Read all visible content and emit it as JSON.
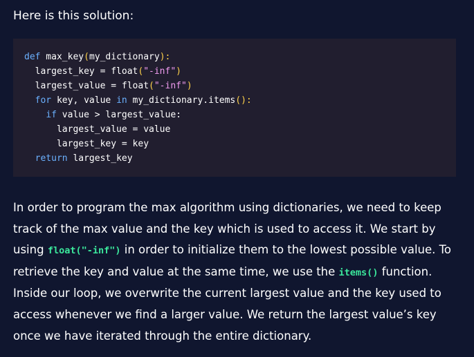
{
  "intro": "Here is this solution:",
  "code": {
    "l1": {
      "kw": "def",
      "fn": " max_key",
      "p1": "(",
      "arg": "my_dictionary",
      "p2": "):"
    },
    "l2": {
      "a": "largest_key = float",
      "p1": "(",
      "s": "\"-inf\"",
      "p2": ")"
    },
    "l3": {
      "a": "largest_value = float",
      "p1": "(",
      "s": "\"-inf\"",
      "p2": ")"
    },
    "l4": {
      "kw1": "for",
      "a": " key, value ",
      "kw2": "in",
      "b": " my_dictionary.items",
      "p": "():"
    },
    "l5": {
      "kw": "if",
      "a": " value > largest_value:"
    },
    "l6": "largest_value = value",
    "l7": "largest_key = key",
    "l8": {
      "kw": "return",
      "a": " largest_key"
    }
  },
  "prose": {
    "t1": "In order to program the max algorithm using dictionaries, we need to keep track of the max value and the key which is used to access it. We start by using ",
    "c1": "float(\"-inf\")",
    "t2": " in order to initialize them to the lowest possible value. To retrieve the key and value at the same time, we use the ",
    "c2": "items()",
    "t3": " function. Inside our loop, we overwrite the current largest value and the key used to access whenever we find a larger value. We return the largest value’s key once we have iterated through the entire dictionary."
  },
  "colors": {
    "background": "#10162f",
    "code_background": "#211e2f",
    "keyword": "#6bb1ff",
    "punctuation": "#ffd24a",
    "string": "#f09cf0",
    "inline_code": "#3be89c"
  }
}
